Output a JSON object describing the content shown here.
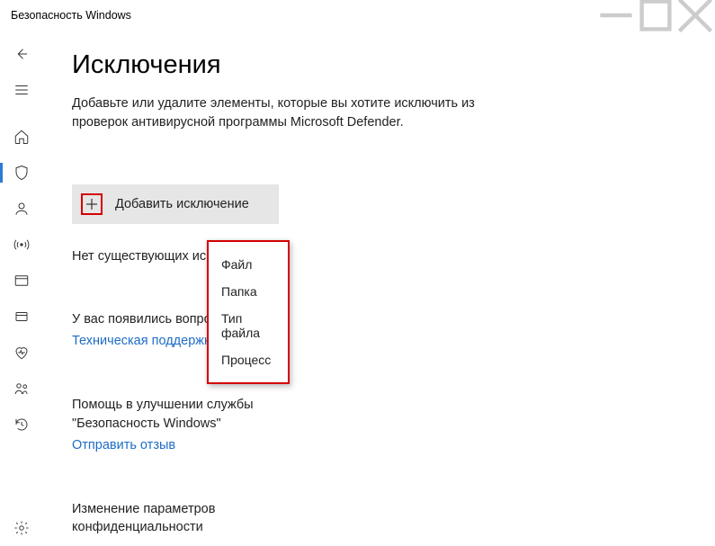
{
  "titlebar": {
    "title": "Безопасность Windows"
  },
  "nav": {
    "items": [
      {
        "name": "back-button"
      },
      {
        "name": "menu-button"
      },
      {
        "name": "home-button"
      },
      {
        "name": "shield-button",
        "active": true
      },
      {
        "name": "account-button"
      },
      {
        "name": "firewall-button"
      },
      {
        "name": "app-browser-button"
      },
      {
        "name": "device-security-button"
      },
      {
        "name": "device-health-button"
      },
      {
        "name": "family-button"
      },
      {
        "name": "history-button"
      }
    ],
    "settings": {
      "name": "settings-button"
    }
  },
  "page": {
    "heading": "Исключения",
    "description": "Добавьте или удалите элементы, которые вы хотите исключить из проверок антивирусной программы Microsoft Defender.",
    "add_button_label": "Добавить исключение",
    "no_exclusions_text": "Нет существующих исключений.",
    "questions_label": "У вас появились вопросы?",
    "support_link": "Техническая поддержка",
    "improve_label": "Помощь в улучшении службы \"Безопасность Windows\"",
    "feedback_link": "Отправить отзыв",
    "privacy_heading": "Изменение параметров конфиденциальности"
  },
  "dropdown": {
    "items": [
      {
        "label": "Файл"
      },
      {
        "label": "Папка"
      },
      {
        "label": "Тип файла"
      },
      {
        "label": "Процесс"
      }
    ]
  }
}
